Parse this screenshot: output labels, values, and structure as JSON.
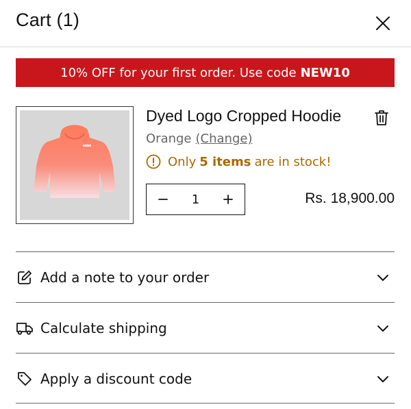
{
  "header": {
    "title": "Cart (1)"
  },
  "promo": {
    "text": "10% OFF for your first order. Use code",
    "code": "NEW10",
    "background": "#c8171c"
  },
  "item": {
    "title": "Dyed Logo Cropped Hoodie",
    "variant": "Orange",
    "change_label": "(Change)",
    "stock_prefix": "Only",
    "stock_count": "5 items",
    "stock_suffix": "are in stock!",
    "stock_color": "#a86a00",
    "quantity": "1",
    "price": "Rs. 18,900.00",
    "image_icon": "hoodie-image"
  },
  "accordion": [
    {
      "label": "Add a note to your order",
      "icon": "edit-icon"
    },
    {
      "label": "Calculate shipping",
      "icon": "truck-icon"
    },
    {
      "label": "Apply a discount code",
      "icon": "tag-icon"
    }
  ]
}
